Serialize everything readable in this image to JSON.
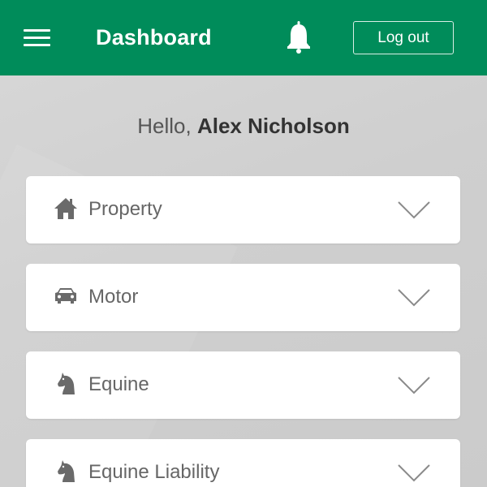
{
  "header": {
    "title": "Dashboard",
    "logout_label": "Log out",
    "color": "#008c5a"
  },
  "greeting": {
    "prefix": "Hello, ",
    "name": "Alex Nicholson"
  },
  "categories": [
    {
      "label": "Property",
      "icon": "house-icon"
    },
    {
      "label": "Motor",
      "icon": "car-icon"
    },
    {
      "label": "Equine",
      "icon": "horse-icon"
    },
    {
      "label": "Equine Liability",
      "icon": "horse-icon"
    }
  ]
}
